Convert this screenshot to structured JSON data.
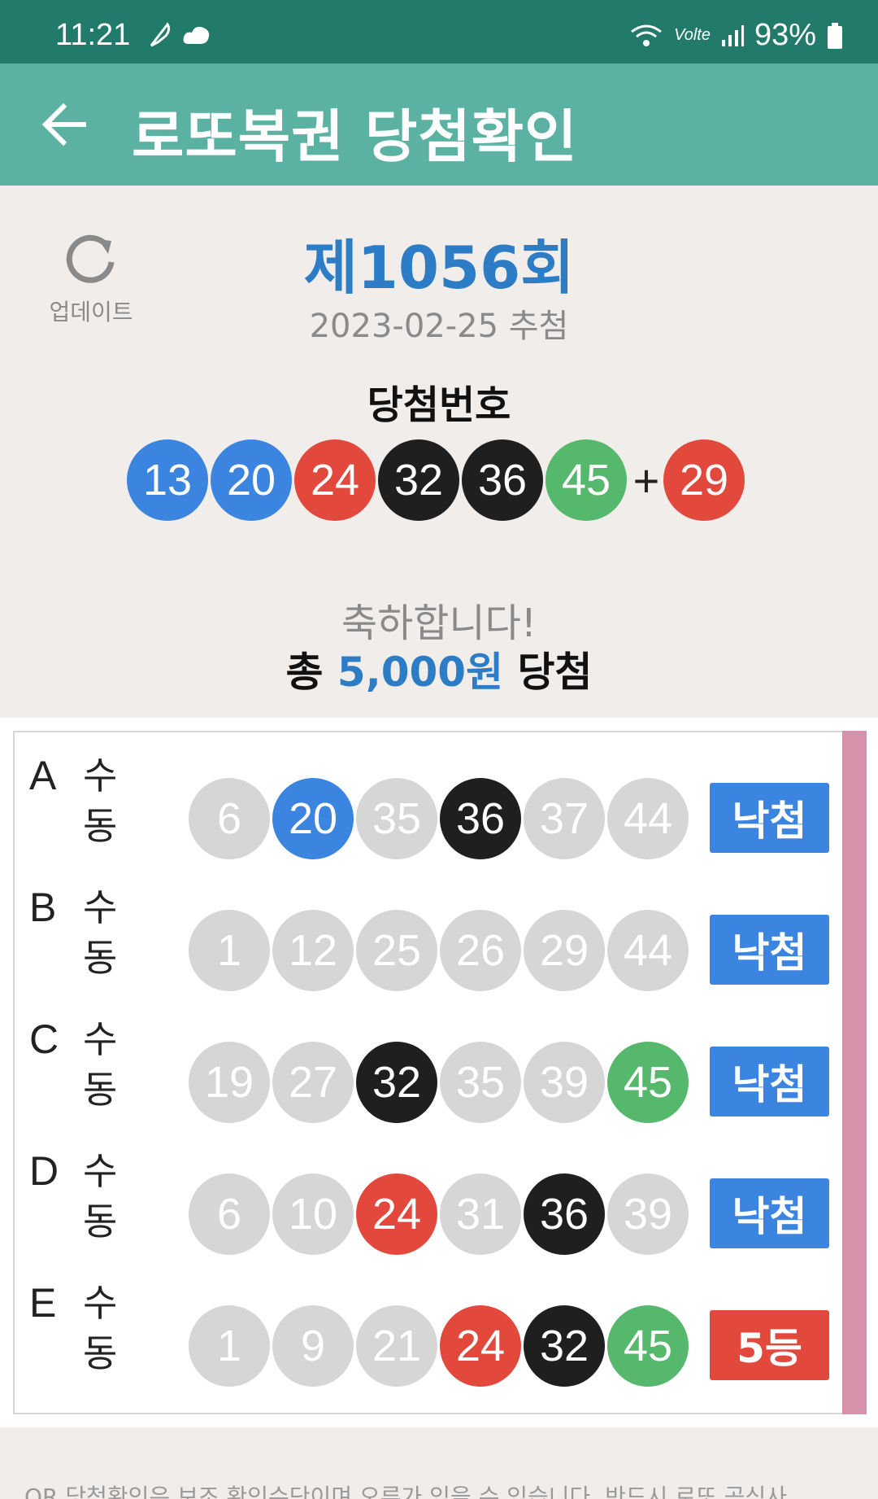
{
  "status_bar": {
    "time": "11:21",
    "battery": "93%",
    "network": "Volte"
  },
  "app_bar": {
    "title": "로또복권 당첨확인"
  },
  "header": {
    "refresh_label": "업데이트",
    "round": "제1056회",
    "draw_date": "2023-02-25 추첨",
    "win_label": "당첨번호",
    "winning_numbers": [
      "13",
      "20",
      "24",
      "32",
      "36",
      "45"
    ],
    "bonus_number": "29",
    "plus": "+",
    "congrats": "축하합니다!",
    "total_prefix": "총",
    "total_amount": "5,000원",
    "total_suffix": "당첨"
  },
  "colors": {
    "blue": "#3b84e0",
    "red": "#e2483b",
    "black": "#1f1f1f",
    "green": "#55b86c",
    "gray": "#d6d6d6"
  },
  "tickets": [
    {
      "letter": "A",
      "type": "수동",
      "numbers": [
        "6",
        "20",
        "35",
        "36",
        "37",
        "44"
      ],
      "matched": [
        false,
        true,
        false,
        true,
        false,
        false
      ],
      "result": "낙첨",
      "result_color": "#3b84e0"
    },
    {
      "letter": "B",
      "type": "수동",
      "numbers": [
        "1",
        "12",
        "25",
        "26",
        "29",
        "44"
      ],
      "matched": [
        false,
        false,
        false,
        false,
        false,
        false
      ],
      "result": "낙첨",
      "result_color": "#3b84e0"
    },
    {
      "letter": "C",
      "type": "수동",
      "numbers": [
        "19",
        "27",
        "32",
        "35",
        "39",
        "45"
      ],
      "matched": [
        false,
        false,
        true,
        false,
        false,
        true
      ],
      "result": "낙첨",
      "result_color": "#3b84e0"
    },
    {
      "letter": "D",
      "type": "수동",
      "numbers": [
        "6",
        "10",
        "24",
        "31",
        "36",
        "39"
      ],
      "matched": [
        false,
        false,
        true,
        false,
        true,
        false
      ],
      "result": "낙첨",
      "result_color": "#3b84e0"
    },
    {
      "letter": "E",
      "type": "수동",
      "numbers": [
        "1",
        "9",
        "21",
        "24",
        "32",
        "45"
      ],
      "matched": [
        false,
        false,
        false,
        true,
        true,
        true
      ],
      "result": "5등",
      "result_color": "#e2483b"
    }
  ],
  "footer": {
    "note": "QR 당첨확인은 보조 확인수단이며 오류가 있을 수 있습니다. 반드시 로또 공식사"
  }
}
